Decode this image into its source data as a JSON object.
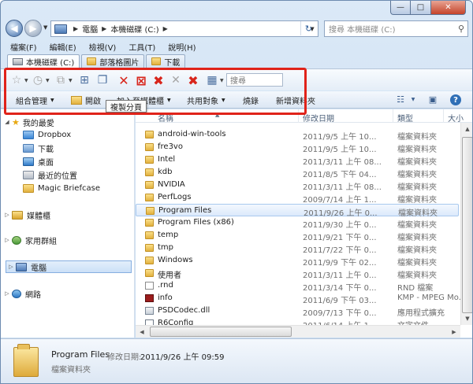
{
  "window": {
    "caption": {
      "minimize": "—",
      "maximize": "□",
      "close": "✕"
    }
  },
  "address_bar": {
    "segments": [
      "電腦",
      "本機磁碟 (C:)"
    ],
    "search_placeholder": "搜尋 本機磁碟 (C:)"
  },
  "menu": [
    "檔案(F)",
    "編輯(E)",
    "檢視(V)",
    "工具(T)",
    "說明(H)"
  ],
  "tabs": [
    {
      "label": "本機磁碟 (C:)",
      "icon": "drive-icon"
    },
    {
      "label": "部落格圖片",
      "icon": "folder-icon"
    },
    {
      "label": "下載",
      "icon": "folder-icon"
    }
  ],
  "tab_toolbar": {
    "search_placeholder": "搜尋"
  },
  "command_bar": {
    "organize": "組合管理",
    "open": "開啟",
    "include_library": "加入至媒體櫃",
    "share": "共用對象",
    "burn": "燒錄",
    "new_folder": "新增資料夾"
  },
  "tooltip": "複製分頁",
  "nav": {
    "favorites": "我的最愛",
    "favorites_items": [
      "Dropbox",
      "下載",
      "桌面",
      "最近的位置",
      "Magic Briefcase"
    ],
    "libraries": "媒體櫃",
    "homegroup": "家用群組",
    "computer": "電腦",
    "network": "網路"
  },
  "columns": {
    "name": "名稱",
    "date": "修改日期",
    "type": "類型",
    "size": "大小"
  },
  "files": [
    {
      "name": "android-win-tools",
      "date": "2011/9/5 上午 10...",
      "type": "檔案資料夾",
      "icon": "folder"
    },
    {
      "name": "fre3vo",
      "date": "2011/9/5 上午 10...",
      "type": "檔案資料夾",
      "icon": "folder"
    },
    {
      "name": "Intel",
      "date": "2011/3/11 上午 08...",
      "type": "檔案資料夾",
      "icon": "folder"
    },
    {
      "name": "kdb",
      "date": "2011/8/5 下午 04...",
      "type": "檔案資料夾",
      "icon": "folder"
    },
    {
      "name": "NVIDIA",
      "date": "2011/3/11 上午 08...",
      "type": "檔案資料夾",
      "icon": "folder"
    },
    {
      "name": "PerfLogs",
      "date": "2009/7/14 上午 1...",
      "type": "檔案資料夾",
      "icon": "folder"
    },
    {
      "name": "Program Files",
      "date": "2011/9/26 上午 0...",
      "type": "檔案資料夾",
      "icon": "folder",
      "selected": true
    },
    {
      "name": "Program Files (x86)",
      "date": "2011/9/30 上午 0...",
      "type": "檔案資料夾",
      "icon": "folder"
    },
    {
      "name": "temp",
      "date": "2011/9/21 下午 0...",
      "type": "檔案資料夾",
      "icon": "folder"
    },
    {
      "name": "tmp",
      "date": "2011/7/22 下午 0...",
      "type": "檔案資料夾",
      "icon": "folder"
    },
    {
      "name": "Windows",
      "date": "2011/9/9 下午 02...",
      "type": "檔案資料夾",
      "icon": "folder"
    },
    {
      "name": "使用者",
      "date": "2011/3/11 上午 0...",
      "type": "檔案資料夾",
      "icon": "folder"
    },
    {
      "name": ".rnd",
      "date": "2011/3/14 下午 0...",
      "type": "RND 檔案",
      "icon": "file"
    },
    {
      "name": "info",
      "date": "2011/6/9 下午 03...",
      "type": "KMP - MPEG Mo...",
      "icon": "dat"
    },
    {
      "name": "PSDCodec.dll",
      "date": "2009/7/13 下午 0...",
      "type": "應用程式擴充",
      "icon": "dll"
    },
    {
      "name": "R6Config",
      "date": "2011/6/14 上午 1...",
      "type": "文字文件",
      "icon": "cfg"
    }
  ],
  "details": {
    "name": "Program Files",
    "modified_label": "修改日期:",
    "modified_value": "2011/9/26 上午 09:59",
    "type": "檔案資料夾"
  }
}
